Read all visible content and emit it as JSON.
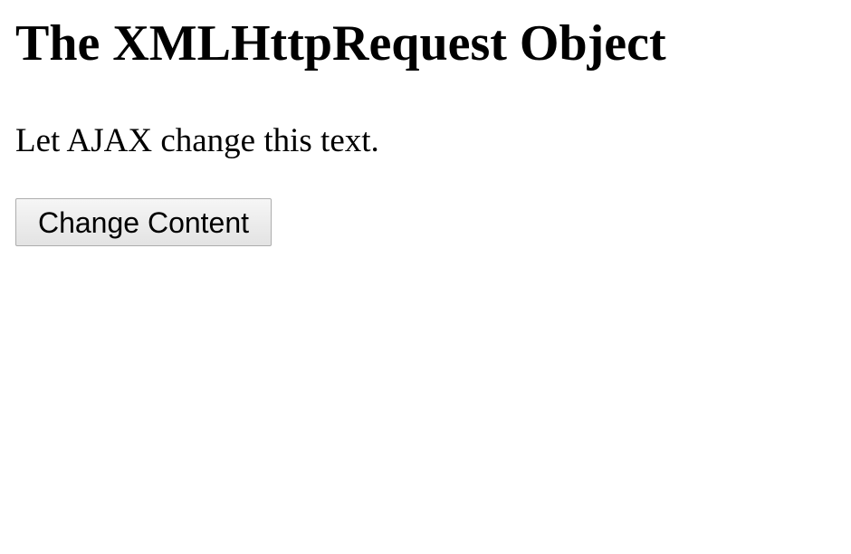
{
  "page": {
    "title": "The XMLHttpRequest Object",
    "demo_text": "Let AJAX change this text.",
    "button_label": "Change Content"
  }
}
